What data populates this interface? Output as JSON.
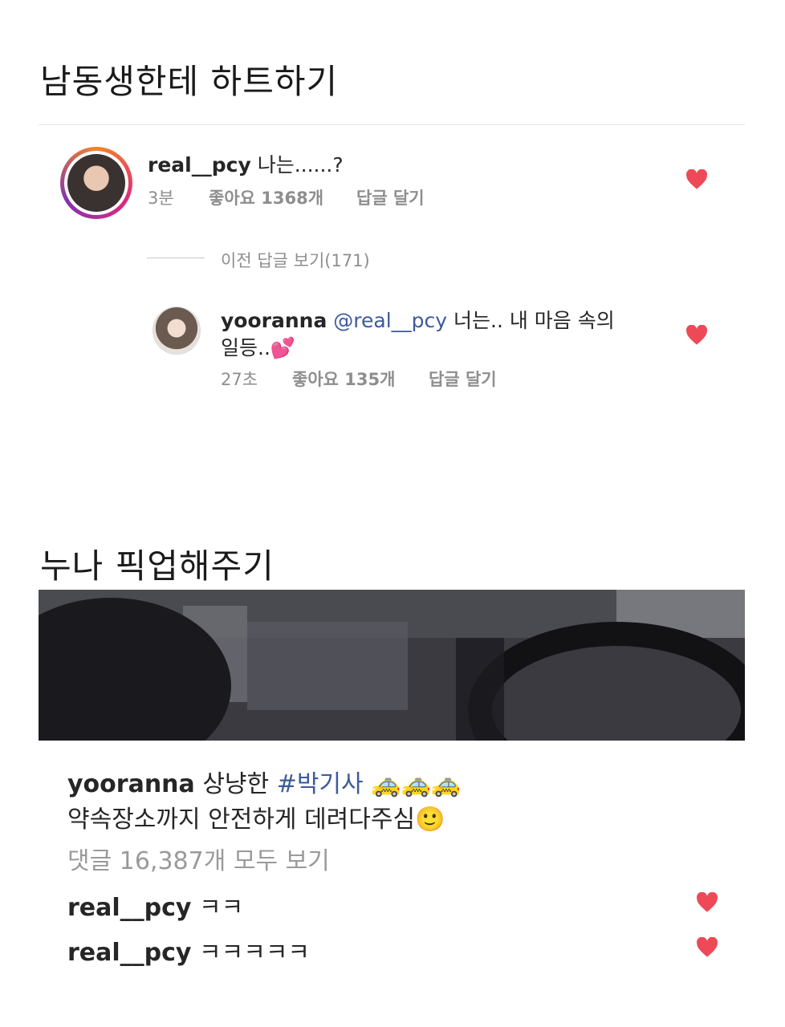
{
  "section1": {
    "title": "남동생한테 하트하기",
    "comment": {
      "username": "real__pcy",
      "text": "나는......?",
      "time": "3분",
      "likes": "좋아요 1368개",
      "reply": "답글 달기"
    },
    "view_replies": "이전 답글 보기(171)",
    "reply": {
      "username": "yooranna",
      "mention": "@real__pcy",
      "text_line1": "너는.. 내 마음 속의",
      "text_line2": "일등..💕",
      "time": "27초",
      "likes": "좋아요 135개",
      "reply": "답글 달기"
    }
  },
  "section2": {
    "title": "누나 픽업해주기",
    "caption": {
      "username": "yooranna",
      "text": "상냥한",
      "hashtag": "#박기사",
      "emoji": "🚕🚕🚕",
      "line2": "약속장소까지 안전하게 데려다주심🙂"
    },
    "view_all": "댓글 16,387개 모두 보기",
    "comments": [
      {
        "username": "real__pcy",
        "text": "ㅋㅋ"
      },
      {
        "username": "real__pcy",
        "text": "ㅋㅋㅋㅋㅋ"
      }
    ]
  },
  "colors": {
    "heart": "#ed4956",
    "hashtag": "#3d5a9a"
  }
}
